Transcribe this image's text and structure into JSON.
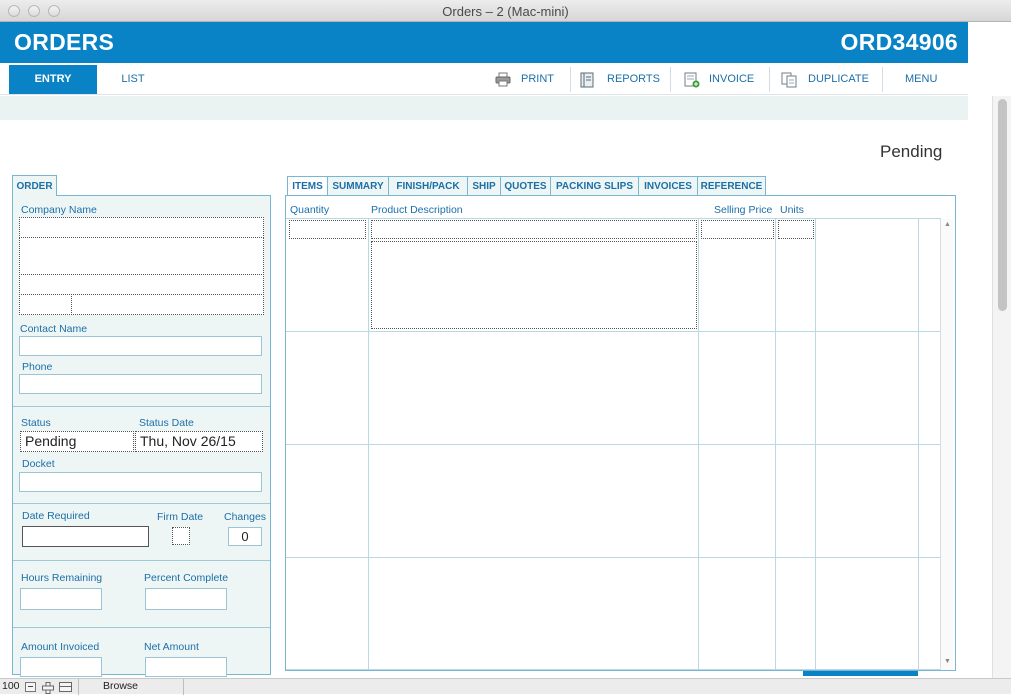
{
  "window": {
    "title": "Orders – 2 (Mac-mini)"
  },
  "header": {
    "app_title": "ORDERS",
    "order_number": "ORD34906"
  },
  "nav": {
    "tabs": [
      {
        "label": "ENTRY"
      },
      {
        "label": "LIST"
      }
    ],
    "buttons": [
      {
        "label": "PRINT",
        "icon": "printer-icon"
      },
      {
        "label": "REPORTS",
        "icon": "notebook-icon"
      },
      {
        "label": "INVOICE",
        "icon": "invoice-icon"
      },
      {
        "label": "DUPLICATE",
        "icon": "duplicate-icon"
      },
      {
        "label": "MENU"
      }
    ]
  },
  "record": {
    "status": "Pending"
  },
  "order_panel": {
    "tab_label": "ORDER",
    "company_name_label": "Company Name",
    "contact_name_label": "Contact Name",
    "phone_label": "Phone",
    "status_label": "Status",
    "status_value": "Pending",
    "status_date_label": "Status Date",
    "status_date_value": "Thu, Nov 26/15",
    "docket_label": "Docket",
    "date_required_label": "Date Required",
    "firm_date_label": "Firm Date",
    "changes_label": "Changes",
    "changes_value": "0",
    "hours_remaining_label": "Hours Remaining",
    "percent_complete_label": "Percent Complete",
    "amount_invoiced_label": "Amount Invoiced",
    "net_amount_label": "Net Amount"
  },
  "detail_tabs": [
    {
      "label": "ITEMS"
    },
    {
      "label": "SUMMARY"
    },
    {
      "label": "FINISH/PACK"
    },
    {
      "label": "SHIP"
    },
    {
      "label": "QUOTES"
    },
    {
      "label": "PACKING SLIPS"
    },
    {
      "label": "INVOICES"
    },
    {
      "label": "REFERENCE"
    }
  ],
  "items_table": {
    "columns": [
      {
        "label": "Quantity"
      },
      {
        "label": "Product Description"
      },
      {
        "label": "Selling Price"
      },
      {
        "label": "Units"
      }
    ]
  },
  "statusbar": {
    "zoom": "100",
    "mode": "Browse"
  },
  "colors": {
    "brand": "#0a82c6",
    "panel_bg": "#eef6f5",
    "label": "#1b6fa8"
  }
}
